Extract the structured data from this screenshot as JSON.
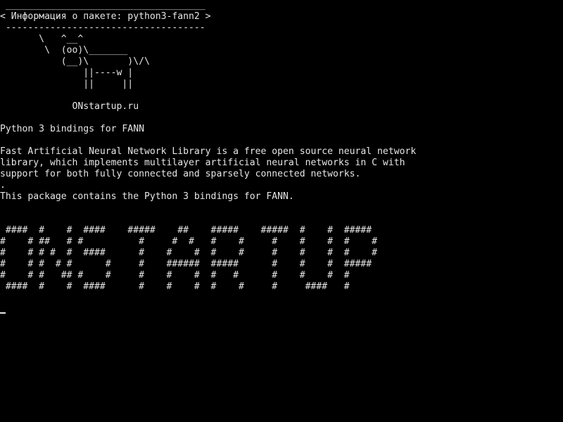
{
  "terminal": {
    "colors": {
      "background": "#000000",
      "foreground": "#e6e6e6"
    },
    "bubble": {
      "top_border": " ____________________________________",
      "title": "< Информация о пакете: python3-fann2 >",
      "bottom_border": " ------------------------------------"
    },
    "cow": [
      "       \\   ^__^",
      "        \\  (oo)\\_______",
      "           (__)\\       )\\/\\",
      "               ||----w |",
      "               ||     ||"
    ],
    "site": "             ONstartup.ru",
    "description": {
      "short": "Python 3 bindings for FANN",
      "long": [
        "Fast Artificial Neural Network Library is a free open source neural network",
        "library, which implements multilayer artificial neural networks in C with",
        "support for both fully connected and sparsely connected networks.",
        ".",
        "This package contains the Python 3 bindings for FANN."
      ]
    },
    "banner": [
      " ####  #    #  ####    #####    ##    #####    #####  #    #  #####",
      "#    # ##   # #          #     #  #   #    #     #    #    #  #    #",
      "#    # # #  #  ####      #    #    #  #    #     #    #    #  #    #",
      "#    # #  # #      #     #    ######  #####      #    #    #  #####",
      "#    # #   ## #    #     #    #    #  #   #      #    #    #  #",
      " ####  #    #  ####      #    #    #  #    #     #     ####   #"
    ]
  }
}
